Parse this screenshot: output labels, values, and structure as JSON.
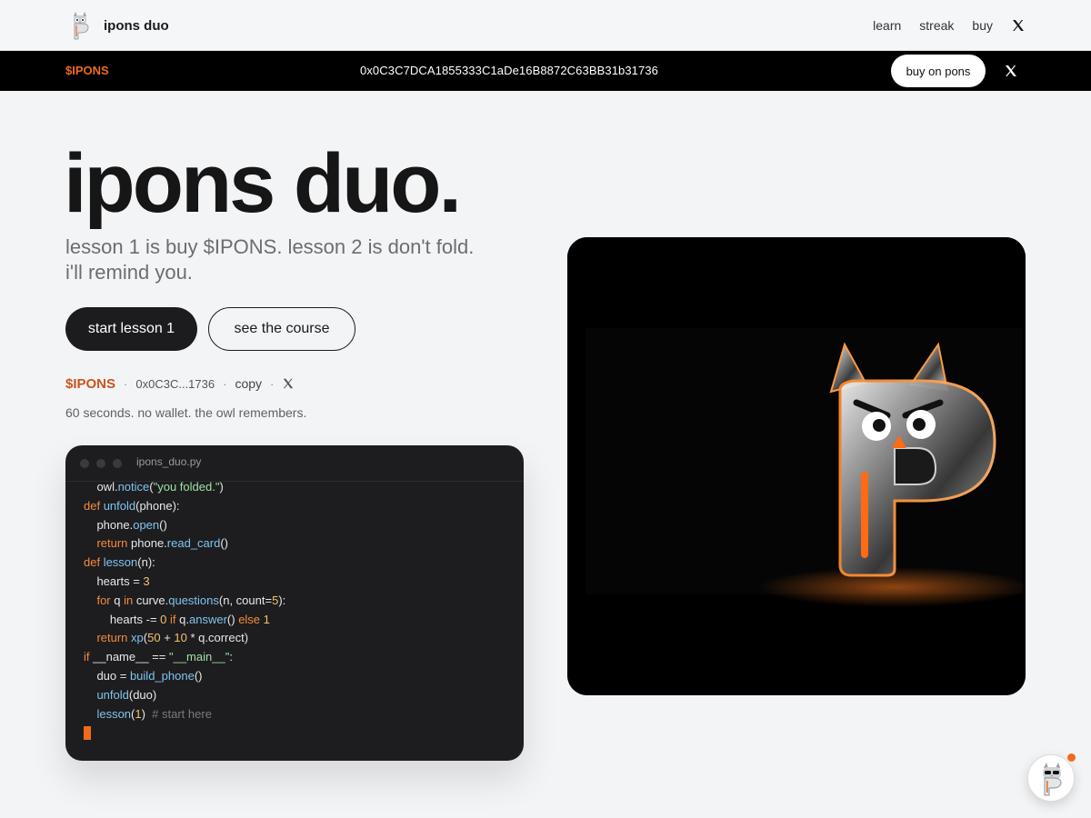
{
  "nav": {
    "brand": "ipons duo",
    "links": [
      "learn",
      "streak",
      "buy"
    ],
    "x_icon": "x-logo-icon"
  },
  "ticker": {
    "symbol": "$IPONS",
    "address": "0x0C3C7DCA1855333C1aDe16B8872C63BB31b31736",
    "buy_label": "buy on pons"
  },
  "hero": {
    "title": "ipons duo.",
    "subtitle": "lesson 1 is buy $IPONS. lesson 2 is don't fold. i'll remind you.",
    "primary_cta": "start lesson 1",
    "secondary_cta": "see the course",
    "token_symbol": "$IPONS",
    "token_address_short": "0x0C3C...1736",
    "copy_label": "copy",
    "tagline": "60 seconds. no wallet. the owl remembers."
  },
  "code": {
    "filename": "ipons_duo.py",
    "lines": [
      [
        {
          "t": "    owl."
        },
        {
          "t": "notice",
          "c": "fn"
        },
        {
          "t": "("
        },
        {
          "t": "\"you folded.\"",
          "c": "str"
        },
        {
          "t": ")"
        }
      ],
      [
        {
          "t": "def ",
          "c": "kw"
        },
        {
          "t": "unfold",
          "c": "fn"
        },
        {
          "t": "(phone):"
        }
      ],
      [
        {
          "t": "    phone."
        },
        {
          "t": "open",
          "c": "fn"
        },
        {
          "t": "()"
        }
      ],
      [
        {
          "t": "    "
        },
        {
          "t": "return ",
          "c": "kw"
        },
        {
          "t": "phone."
        },
        {
          "t": "read_card",
          "c": "fn"
        },
        {
          "t": "()"
        }
      ],
      [
        {
          "t": "def ",
          "c": "kw"
        },
        {
          "t": "lesson",
          "c": "fn"
        },
        {
          "t": "(n):"
        }
      ],
      [
        {
          "t": "    hearts = "
        },
        {
          "t": "3",
          "c": "num"
        }
      ],
      [
        {
          "t": "    "
        },
        {
          "t": "for ",
          "c": "kw"
        },
        {
          "t": "q "
        },
        {
          "t": "in ",
          "c": "kw"
        },
        {
          "t": "curve."
        },
        {
          "t": "questions",
          "c": "fn"
        },
        {
          "t": "(n, count="
        },
        {
          "t": "5",
          "c": "num"
        },
        {
          "t": "):"
        }
      ],
      [
        {
          "t": "        hearts -= "
        },
        {
          "t": "0 ",
          "c": "num"
        },
        {
          "t": "if ",
          "c": "kw"
        },
        {
          "t": "q."
        },
        {
          "t": "answer",
          "c": "fn"
        },
        {
          "t": "() "
        },
        {
          "t": "else ",
          "c": "kw"
        },
        {
          "t": "1",
          "c": "num"
        }
      ],
      [
        {
          "t": "    "
        },
        {
          "t": "return ",
          "c": "kw"
        },
        {
          "t": "xp",
          "c": "fn"
        },
        {
          "t": "("
        },
        {
          "t": "50",
          "c": "num"
        },
        {
          "t": " + "
        },
        {
          "t": "10",
          "c": "num"
        },
        {
          "t": " * q.correct)"
        }
      ],
      [
        {
          "t": "if ",
          "c": "kw"
        },
        {
          "t": "__name__ == "
        },
        {
          "t": "\"__main__\"",
          "c": "str"
        },
        {
          "t": ":"
        }
      ],
      [
        {
          "t": "    duo = "
        },
        {
          "t": "build_phone",
          "c": "fn"
        },
        {
          "t": "()"
        }
      ],
      [
        {
          "t": "    "
        },
        {
          "t": "unfold",
          "c": "fn"
        },
        {
          "t": "(duo)"
        }
      ],
      [
        {
          "t": "    "
        },
        {
          "t": "lesson",
          "c": "fn"
        },
        {
          "t": "("
        },
        {
          "t": "1",
          "c": "num"
        },
        {
          "t": ")  "
        },
        {
          "t": "# start here",
          "c": "cm"
        }
      ]
    ]
  },
  "colors": {
    "accent": "#f26b1d",
    "ticker_bg": "#000000",
    "page_bg": "#f3f4f6"
  },
  "icons": {
    "brand_logo": "owl-p-logo-icon",
    "hero_image": "glass-p-owl-mascot",
    "float_avatar": "owl-avatar-icon"
  }
}
